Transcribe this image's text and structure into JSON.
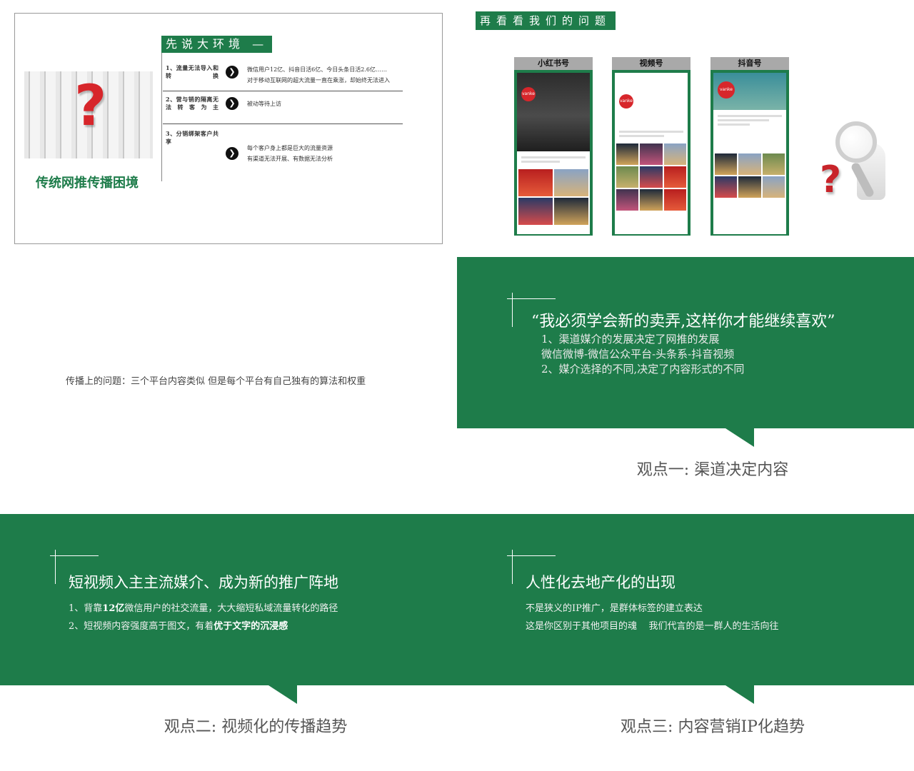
{
  "slide1": {
    "section_head": "先说大环境 —",
    "left_title": "传统网推传播困境",
    "rows": [
      {
        "label": "1、流量无法导入和转换",
        "arrow": "❯",
        "desc": [
          "微信用户12亿、抖音日活6亿、今日头条日活2.6亿……",
          "对于移动互联网的超大流量一直在乘涨，却始终无法进入"
        ]
      },
      {
        "label": "2、营与销的隔离无法转客为主",
        "arrow": "❯",
        "desc": [
          "被动等待上访"
        ]
      },
      {
        "label": "3、分销绑架客户共享",
        "arrow": "❯",
        "desc": [
          "每个客户身上都是巨大的流量资源",
          "有渠道无法开展、有数据无法分析"
        ]
      }
    ]
  },
  "slide2": {
    "head": "再看看我们的问题",
    "phones": [
      {
        "title": "小红书号"
      },
      {
        "title": "视频号"
      },
      {
        "title": "抖音号"
      }
    ],
    "logo_text": "vanke"
  },
  "slide3": {
    "caption": "传播上的问题：三个平台内容类似 但是每个平台有自己独有的算法和权重"
  },
  "slide4": {
    "title": "“我必须学会新的卖弄,这样你才能继续喜欢”",
    "lines": [
      "1、渠道媒介的发展决定了网推的发展",
      "微信微博-微信公众平台-头条系-抖音视频",
      "2、媒介选择的不同,决定了内容形式的不同"
    ],
    "caption": "观点一: 渠道决定内容"
  },
  "slide5": {
    "title": "短视频入主主流媒介、成为新的推广阵地",
    "line1_a": "1、背靠",
    "line1_b": "12亿",
    "line1_c": "微信用户的社交流量，大大缩短私域流量转化的路径",
    "line2_a": "2、短视频内容强度高于图文，有着",
    "line2_b": "优于文字的沉浸感",
    "caption": "观点二: 视频化的传播趋势"
  },
  "slide6": {
    "title": "人性化去地产化的出现",
    "lines": [
      "不是狭义的IP推广，是群体标签的建立表达",
      "这是你区别于其他项目的魂    我们代言的是一群人的生活向往"
    ],
    "caption": "观点三: 内容营销IP化趋势"
  }
}
